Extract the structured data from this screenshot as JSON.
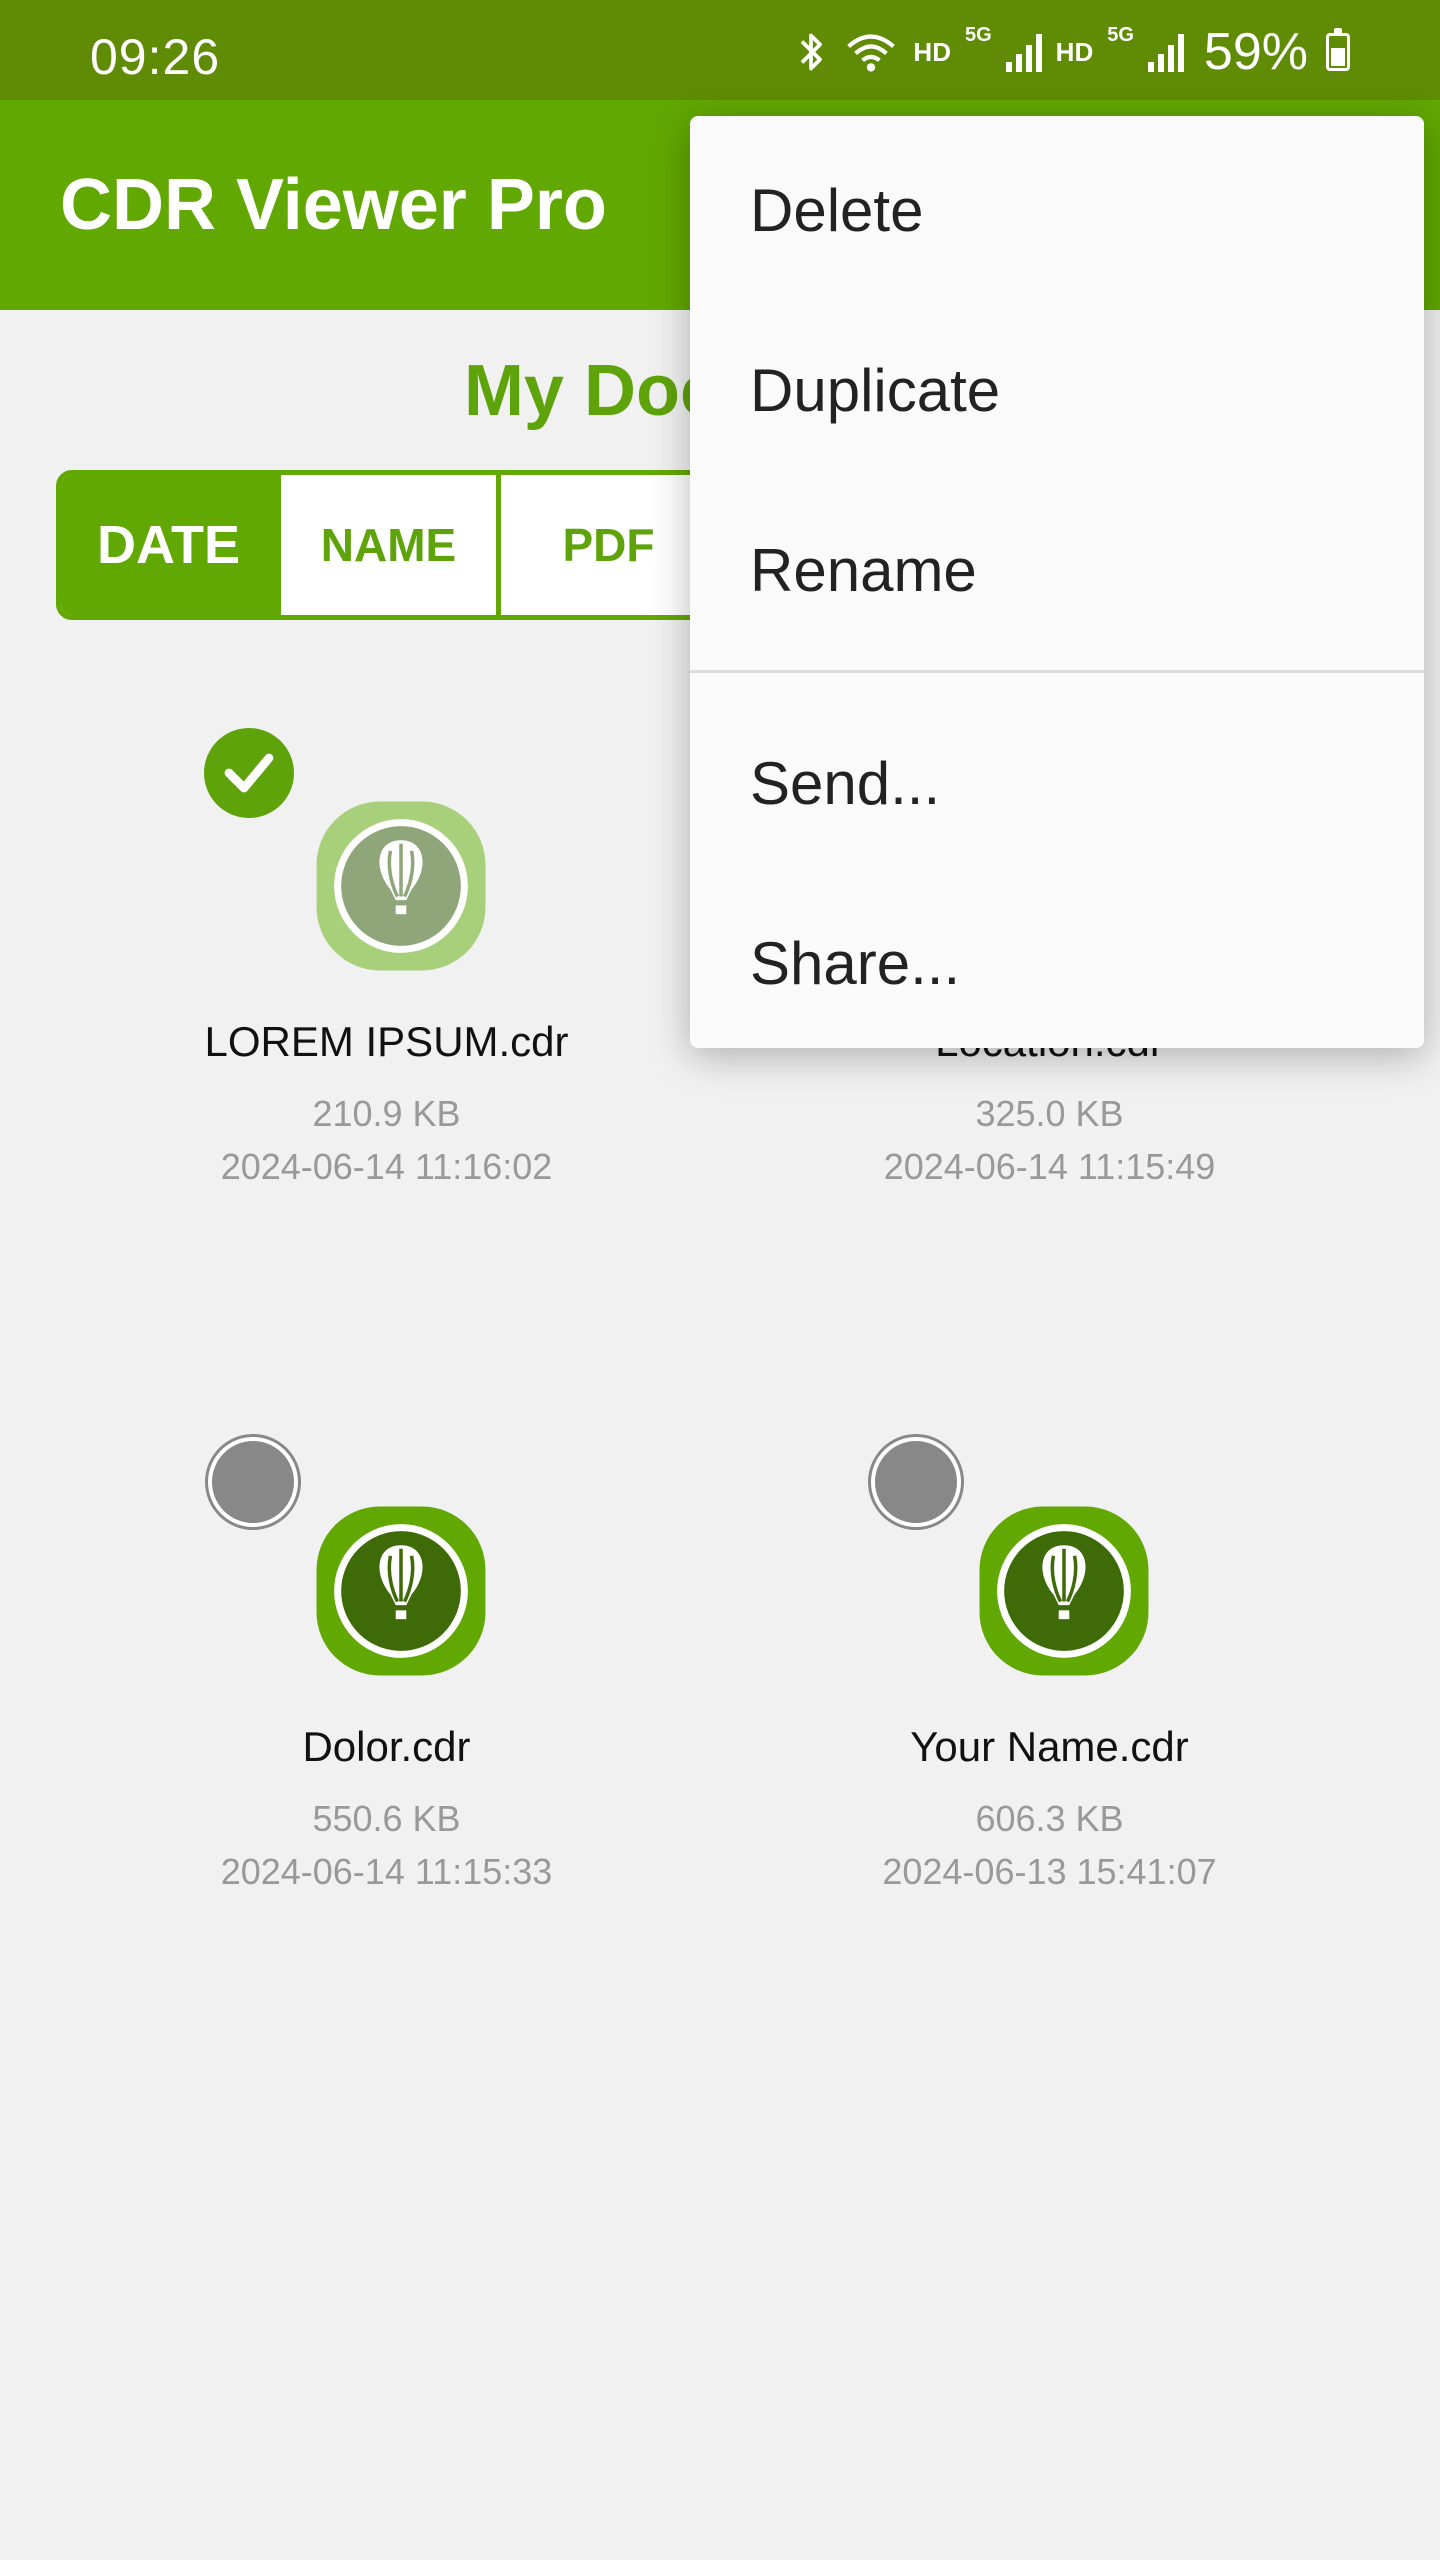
{
  "status_bar": {
    "time": "09:26",
    "network_labels": [
      "HD",
      "5G",
      "HD",
      "5G"
    ],
    "battery": "59%",
    "icons": [
      "bluetooth-icon",
      "wifi-icon",
      "signal-icon",
      "battery-icon"
    ]
  },
  "app_bar": {
    "title": "CDR Viewer Pro"
  },
  "section_title": "My Documents",
  "sort_tabs": [
    {
      "label": "DATE",
      "active": true
    },
    {
      "label": "NAME",
      "active": false
    },
    {
      "label": "PDF",
      "active": false
    }
  ],
  "documents": [
    {
      "name": "LOREM IPSUM.cdr",
      "size": "210.9 KB",
      "date": "2024-06-14 11:16:02",
      "selected": true
    },
    {
      "name": "Location.cdr",
      "size": "325.0 KB",
      "date": "2024-06-14 11:15:49",
      "selected": false
    },
    {
      "name": "Dolor.cdr",
      "size": "550.6 KB",
      "date": "2024-06-14 11:15:33",
      "selected": false
    },
    {
      "name": "Your Name.cdr",
      "size": "606.3 KB",
      "date": "2024-06-13 15:41:07",
      "selected": false
    }
  ],
  "context_menu": {
    "items": [
      "Delete",
      "Duplicate",
      "Rename",
      "Send...",
      "Share..."
    ]
  },
  "colors": {
    "status_bar": "#5f8c04",
    "app_bar": "#62a802",
    "accent": "#5ea30a",
    "icon_dark": "#3e6a07",
    "icon_light_selected": "#a8d07a"
  }
}
